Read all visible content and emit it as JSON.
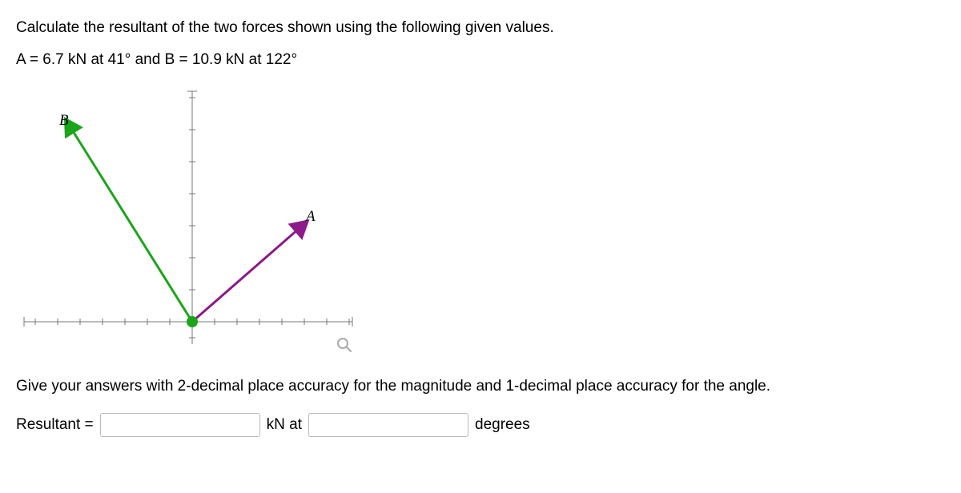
{
  "problem": "Calculate the resultant of the two forces shown using the following given values.",
  "given": "A = 6.7 kN at 41° and B = 10.9 kN at 122°",
  "labels": {
    "A": "A",
    "B": "B"
  },
  "instruction": "Give your answers with 2-decimal place accuracy for the magnitude and 1-decimal place accuracy for the angle.",
  "answer": {
    "label": "Resultant =",
    "mid": "kN at",
    "units": "degrees",
    "magnitude": "",
    "angle": ""
  }
}
